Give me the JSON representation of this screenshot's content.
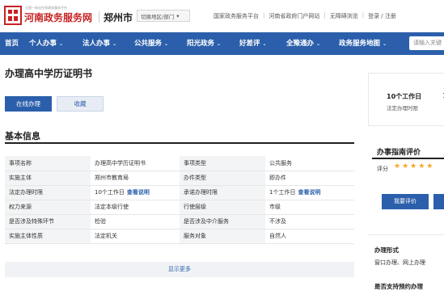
{
  "header": {
    "logo_tagline": "全国一体化在线政务服务平台",
    "site_name": "河南政务服务网",
    "city": "郑州市",
    "switch_label": "切换地区/部门",
    "links": [
      "国家政务服务平台",
      "河南省政府门户网站",
      "无障碍浏览",
      "登录 / 注册"
    ]
  },
  "nav": {
    "items": [
      "首页",
      "个人办事",
      "法人办事",
      "公共服务",
      "阳光政务",
      "好差评",
      "全豫通办",
      "政务服务地图"
    ],
    "search_placeholder": "请输入关键"
  },
  "page": {
    "title": "办理高中学历证明书",
    "primary_button": "在线办理",
    "secondary_button": "收藏"
  },
  "basic_info": {
    "section_title": "基本信息",
    "rows": [
      {
        "k1": "事项名称",
        "v1": "办理高中学历证明书",
        "k2": "事项类型",
        "v2": "公共服务"
      },
      {
        "k1": "实施主体",
        "v1": "郑州市教育局",
        "k2": "办件类型",
        "v2": "即办件"
      },
      {
        "k1": "法定办理时限",
        "v1": "10个工作日",
        "k2": "承诺办理时限",
        "v2": "1个工作日"
      },
      {
        "k1": "权力来源",
        "v1": "法定本级行使",
        "k2": "行使层级",
        "v2": "市级"
      },
      {
        "k1": "是否涉及特殊环节",
        "v1": "检验",
        "k2": "是否涉及中介服务",
        "v2": "不涉及"
      },
      {
        "k1": "实施主体性质",
        "v1": "法定机关",
        "k2": "服务对象",
        "v2": "自然人"
      }
    ],
    "view_note": "查看说明",
    "show_more": "显示更多"
  },
  "sidebar": {
    "time_value": "10个工作日",
    "time_label": "法定办理时限",
    "time_edge": "1",
    "eval_title": "办事指南评价",
    "score_label": "评分",
    "stars": "★★★★★",
    "eval_button": "我要评价",
    "form_title": "办理形式",
    "form_value": "窗口办理、网上办理",
    "cut_title": "是否支持预约办理"
  },
  "colors": {
    "brand_red": "#c72222",
    "nav_blue": "#2b5fab",
    "star": "#f5a623"
  }
}
